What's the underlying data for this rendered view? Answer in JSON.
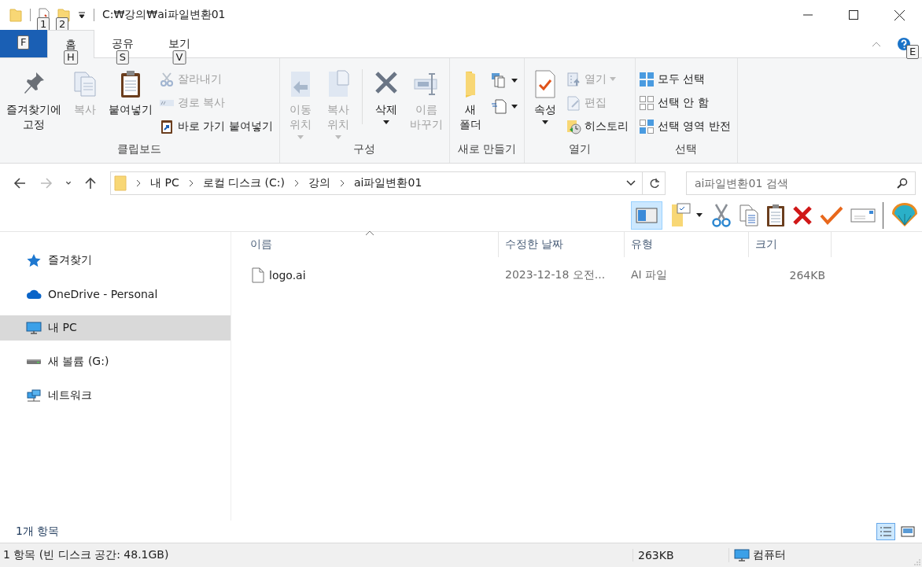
{
  "title_bar": {
    "path": "C:₩강의₩ai파일변환01",
    "quick_access_keytips": [
      "1",
      "2"
    ]
  },
  "ribbon": {
    "tabs": [
      {
        "keytip": "F",
        "selected": false,
        "kind": "file"
      },
      {
        "label": "홈",
        "keytip": "H",
        "selected": true,
        "kind": "normal"
      },
      {
        "label": "공유",
        "keytip": "S",
        "selected": false,
        "kind": "normal"
      },
      {
        "label": "보기",
        "keytip": "V",
        "selected": false,
        "kind": "normal"
      }
    ],
    "help_keytip": "E",
    "groups": [
      {
        "label": "클립보드",
        "items": [
          {
            "kind": "large",
            "label": "즐겨찾기에\n고정",
            "disabled": false,
            "dropdown": false
          },
          {
            "kind": "large",
            "label": "복사",
            "disabled": true,
            "dropdown": false
          },
          {
            "kind": "large",
            "label": "붙여넣기",
            "disabled": false,
            "dropdown": false
          },
          {
            "kind": "stack",
            "children": [
              {
                "label": "잘라내기",
                "disabled": true,
                "dropdown": false
              },
              {
                "label": "경로 복사",
                "disabled": true,
                "dropdown": false
              },
              {
                "label": "바로 가기 붙여넣기",
                "disabled": false,
                "dropdown": false
              }
            ]
          }
        ]
      },
      {
        "label": "구성",
        "items": [
          {
            "kind": "large",
            "label": "이동\n위치",
            "disabled": true,
            "dropdown": true
          },
          {
            "kind": "large",
            "label": "복사\n위치",
            "disabled": true,
            "dropdown": true
          },
          {
            "kind": "separator"
          },
          {
            "kind": "large",
            "label": "삭제",
            "disabled": false,
            "dropdown": true
          },
          {
            "kind": "large",
            "label": "이름\n바꾸기",
            "disabled": true,
            "dropdown": false
          }
        ]
      },
      {
        "label": "새로 만들기",
        "items": [
          {
            "kind": "large",
            "label": "새\n폴더",
            "disabled": false,
            "dropdown": false
          },
          {
            "kind": "iconstack",
            "children": [
              {
                "disabled": false,
                "dropdown": true
              },
              {
                "disabled": false,
                "dropdown": true
              }
            ]
          }
        ]
      },
      {
        "label": "열기",
        "items": [
          {
            "kind": "large",
            "label": "속성",
            "disabled": false,
            "dropdown": true
          },
          {
            "kind": "stack",
            "children": [
              {
                "label": "열기",
                "disabled": true,
                "dropdown": true
              },
              {
                "label": "편집",
                "disabled": true,
                "dropdown": false
              },
              {
                "label": "히스토리",
                "disabled": false,
                "dropdown": false
              }
            ]
          }
        ]
      },
      {
        "label": "선택",
        "items": [
          {
            "kind": "stack",
            "children": [
              {
                "label": "모두 선택",
                "disabled": false,
                "dropdown": false
              },
              {
                "label": "선택 안 함",
                "disabled": false,
                "dropdown": false
              },
              {
                "label": "선택 영역 반전",
                "disabled": false,
                "dropdown": false
              }
            ]
          }
        ]
      }
    ]
  },
  "address_bar": {
    "nav_buttons": [
      {
        "kind": "back",
        "disabled": false
      },
      {
        "kind": "forward",
        "disabled": true
      },
      {
        "kind": "recent",
        "disabled": false
      },
      {
        "kind": "up",
        "disabled": false
      }
    ],
    "crumbs": [
      "내 PC",
      "로컬 디스크 (C:)",
      "강의",
      "ai파일변환01"
    ],
    "search": {
      "placeholder": "ai파일변환01 검색"
    }
  },
  "toolbar": {
    "preview_pane_on": true
  },
  "nav_pane": {
    "items": [
      {
        "kind": "favorites",
        "label": "즐겨찾기",
        "selected": false
      },
      {
        "kind": "cloud",
        "label": "OneDrive - Personal",
        "selected": false
      },
      {
        "kind": "pc",
        "label": "내 PC",
        "selected": true
      },
      {
        "kind": "drive",
        "label": "새 볼륨 (G:)",
        "selected": false
      },
      {
        "kind": "network",
        "label": "네트워크",
        "selected": false
      }
    ]
  },
  "file_list": {
    "columns": [
      {
        "label": "이름",
        "sorted": true
      },
      {
        "label": "수정한 날짜",
        "sorted": false
      },
      {
        "label": "유형",
        "sorted": false
      },
      {
        "label": "크기",
        "sorted": false
      }
    ],
    "rows": [
      {
        "name": "logo.ai",
        "modified": "2023-12-18 오전...",
        "type": "AI 파일",
        "size": "264KB",
        "selected": false
      }
    ]
  },
  "status_bar": {
    "item_count": "1개 항목",
    "view_buttons": [
      {
        "kind": "details",
        "selected": true
      },
      {
        "kind": "large_icons",
        "selected": false
      }
    ]
  },
  "details_bar": {
    "summary": "1 항목 (빈 디스크 공간: 48.1GB)",
    "size": "263KB",
    "location": "컴퓨터"
  }
}
